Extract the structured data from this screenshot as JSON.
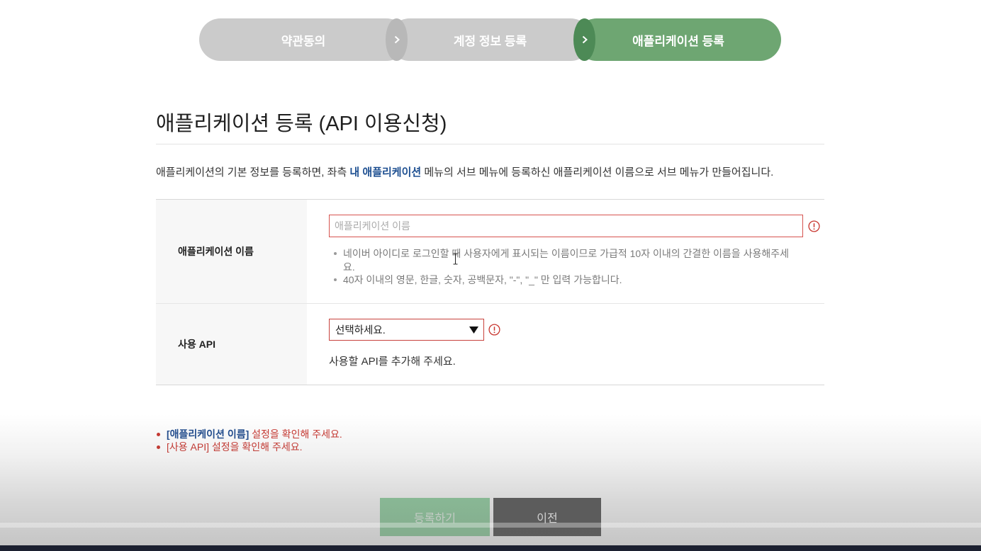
{
  "stepper": {
    "steps": [
      {
        "label": "약관동의"
      },
      {
        "label": "계정 정보 등록"
      },
      {
        "label": "애플리케이션 등록"
      }
    ],
    "current_step": 3
  },
  "page_title": "애플리케이션 등록 (API 이용신청)",
  "description": {
    "before": "애플리케이션의 기본 정보를 등록하면, 좌측",
    "emphasis": "내 애플리케이션",
    "after": "메뉴의 서브 메뉴에 등록하신 애플리케이션 이름으로 서브 메뉴가 만들어집니다."
  },
  "form": {
    "app_name": {
      "label": "애플리케이션 이름",
      "value": "",
      "placeholder": "애플리케이션 이름",
      "hints": [
        "네이버 아이디로 로그인할 때 사용자에게 표시되는 이름이므로 가급적 10자 이내의 간결한 이름을 사용해주세요.",
        "40자 이내의 영문, 한글, 숫자, 공백문자, \"-\", \"_\" 만 입력 가능합니다."
      ]
    },
    "api": {
      "label": "사용 API",
      "selected": "선택하세요.",
      "hint": "사용할 API를 추가해 주세요."
    }
  },
  "errors": [
    {
      "field": "[애플리케이션 이름]",
      "message": "설정을 확인해 주세요."
    },
    {
      "field": "[사용 API]",
      "message": "설정을 확인해 주세요."
    }
  ],
  "buttons": {
    "submit": "등록하기",
    "back": "이전"
  },
  "icons": {
    "step_separator": "chevron-right-icon",
    "field_error": "error-circle-icon",
    "dropdown": "caret-down-icon",
    "mouse_cursor": "text-cursor-icon"
  },
  "colors": {
    "active_step": "#6ea672",
    "inactive_step": "#cbcbcb",
    "error_red": "#c8362f",
    "emphasis_blue": "#1d4f91",
    "submit_button": "#92d2a2",
    "back_button": "#555555"
  }
}
